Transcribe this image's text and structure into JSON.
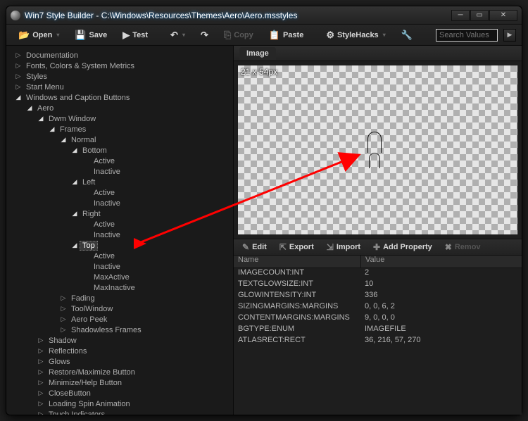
{
  "window": {
    "title": "Win7 Style Builder - C:\\Windows\\Resources\\Themes\\Aero\\Aero.msstyles"
  },
  "toolbar": {
    "open": "Open",
    "save": "Save",
    "test": "Test",
    "copy": "Copy",
    "paste": "Paste",
    "stylehacks": "StyleHacks",
    "search_placeholder": "Search Values"
  },
  "tree": {
    "Documentation": "Documentation",
    "Fonts": "Fonts, Colors & System Metrics",
    "Styles": "Styles",
    "StartMenu": "Start Menu",
    "Windows": "Windows and Caption Buttons",
    "Aero": "Aero",
    "DwmWindow": "Dwm Window",
    "Frames": "Frames",
    "Normal": "Normal",
    "Bottom": "Bottom",
    "Left": "Left",
    "Right": "Right",
    "Top": "Top",
    "Active": "Active",
    "Inactive": "Inactive",
    "MaxActive": "MaxActive",
    "MaxInactive": "MaxInactive",
    "Fading": "Fading",
    "ToolWindow": "ToolWindow",
    "AeroPeek": "Aero Peek",
    "Shadowless": "Shadowless Frames",
    "Shadow": "Shadow",
    "Reflections": "Reflections",
    "Glows": "Glows",
    "RestoreMax": "Restore/Maximize Button",
    "MinHelp": "Minimize/Help Button",
    "CloseButton": "CloseButton",
    "LoadingSpin": "Loading Spin Animation",
    "TouchInd": "Touch Indicators"
  },
  "image": {
    "tab": "Image",
    "dim": "21 x 54px"
  },
  "propbar": {
    "edit": "Edit",
    "export": "Export",
    "import": "Import",
    "addprop": "Add Property",
    "remove": "Remov"
  },
  "propgrid": {
    "colName": "Name",
    "colValue": "Value",
    "rows": [
      {
        "name": "IMAGECOUNT:INT",
        "value": "2"
      },
      {
        "name": "TEXTGLOWSIZE:INT",
        "value": "10"
      },
      {
        "name": "GLOWINTENSITY:INT",
        "value": "336"
      },
      {
        "name": "SIZINGMARGINS:MARGINS",
        "value": "0, 0, 6, 2"
      },
      {
        "name": "CONTENTMARGINS:MARGINS",
        "value": "9, 0, 0, 0"
      },
      {
        "name": "BGTYPE:ENUM",
        "value": "IMAGEFILE"
      },
      {
        "name": "ATLASRECT:RECT",
        "value": "36, 216, 57, 270"
      }
    ]
  }
}
